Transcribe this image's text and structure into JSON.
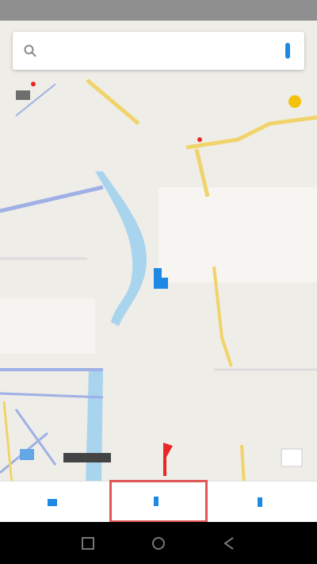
{
  "status_bar": {
    "left_text": "",
    "right_text": ""
  },
  "search": {
    "text": "",
    "icon": "search-icon"
  },
  "map": {
    "labels": [
      {
        "id": "l1",
        "text": ""
      },
      {
        "id": "l2",
        "text": ""
      },
      {
        "id": "l3",
        "text": ""
      },
      {
        "id": "l4",
        "text": ""
      },
      {
        "id": "l5",
        "text": ""
      },
      {
        "id": "l6",
        "text": ""
      },
      {
        "id": "l7",
        "text": ""
      },
      {
        "id": "l8",
        "text": ""
      },
      {
        "id": "l9",
        "text": ""
      },
      {
        "id": "l10",
        "text": ""
      }
    ]
  },
  "bottom_bar": {
    "left_label": "",
    "center_label": "",
    "right_label": ""
  },
  "colors": {
    "map_background": "#efede8",
    "water": "#a8d4ee",
    "road_major": "#f1d36b",
    "road_blue": "#9fb0e6",
    "pin_red": "#e82626",
    "location_blue": "#1e88e5",
    "highlight": "#e15656"
  }
}
